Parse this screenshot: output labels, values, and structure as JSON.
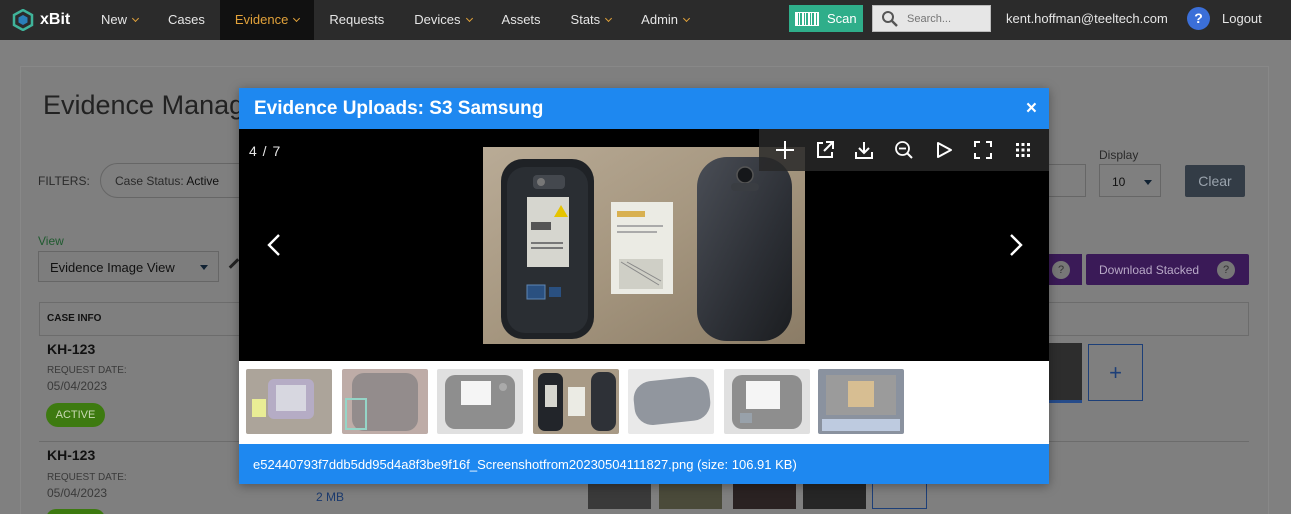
{
  "app": {
    "brand": "xBit",
    "nav": [
      {
        "label": "New",
        "has_caret": true,
        "active": false
      },
      {
        "label": "Cases",
        "has_caret": false,
        "active": false
      },
      {
        "label": "Evidence",
        "has_caret": true,
        "active": true
      },
      {
        "label": "Requests",
        "has_caret": false,
        "active": false
      },
      {
        "label": "Devices",
        "has_caret": true,
        "active": false
      },
      {
        "label": "Assets",
        "has_caret": false,
        "active": false
      },
      {
        "label": "Stats",
        "has_caret": true,
        "active": false
      },
      {
        "label": "Admin",
        "has_caret": true,
        "active": false
      }
    ],
    "scan_label": "Scan",
    "search_placeholder": "Search...",
    "user_email": "kent.hoffman@teeltech.com",
    "help_label": "?",
    "logout_label": "Logout",
    "colors": {
      "accent": "#1e88f0",
      "nav_bg": "#2b2b2b",
      "nav_active": "#e2a23a",
      "scan": "#2fae8a"
    }
  },
  "background_page": {
    "title": "Evidence Manag",
    "filters_label": "FILTERS:",
    "filter_chip_key": "Case Status:",
    "filter_chip_value": "Active",
    "view_label": "View",
    "view_value": "Evidence Image View",
    "display_label": "Display",
    "display_value": "10",
    "clear_label": "Clear",
    "download_stacked_label": "Download Stacked",
    "help_symbol": "?",
    "case_info_header": "CASE INFO",
    "rows": [
      {
        "case_id": "KH-123",
        "request_date_label": "REQUEST DATE:",
        "request_date": "05/04/2023",
        "status": "ACTIVE"
      },
      {
        "case_id": "KH-123",
        "request_date_label": "REQUEST DATE:",
        "request_date": "05/04/2023",
        "size": "2 MB"
      }
    ],
    "plus_symbol": "+"
  },
  "modal": {
    "title": "Evidence Uploads: S3 Samsung",
    "close_symbol": "×",
    "counter": "4 / 7",
    "toolbar": [
      {
        "name": "zoom-in-icon"
      },
      {
        "name": "open-new-window-icon"
      },
      {
        "name": "download-icon"
      },
      {
        "name": "zoom-out-icon"
      },
      {
        "name": "slideshow-play-icon"
      },
      {
        "name": "fullscreen-icon"
      },
      {
        "name": "thumbnails-grid-icon"
      }
    ],
    "thumbnails_count": 7,
    "current_index": 4,
    "footer_caption": "e52440793f7ddb5dd95d4a8f3be9f16f_Screenshotfrom20230504111827.png (size: 106.91 KB)"
  }
}
